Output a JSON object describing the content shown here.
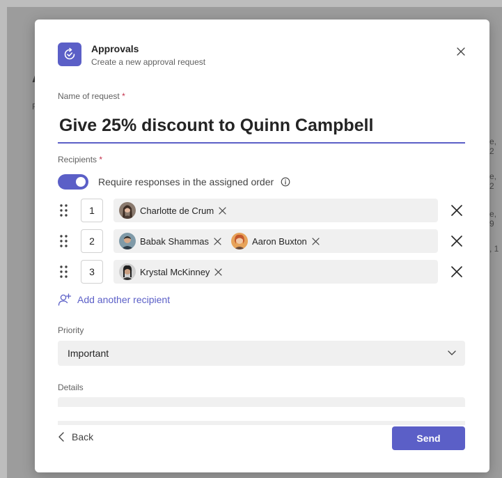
{
  "background": {
    "fragments": [
      "A",
      "F",
      "e, 2",
      "e, 2",
      "e, 9",
      ", 1"
    ]
  },
  "dialog": {
    "app_title": "Approvals",
    "app_subtitle": "Create a new approval request",
    "name_label": "Name of request",
    "required_mark": "*",
    "name_value": "Give 25% discount to Quinn Campbell",
    "recipients_label": "Recipients",
    "toggle_label": "Require responses in the assigned order",
    "toggle_on": true,
    "recipients": [
      {
        "order": "1",
        "people": [
          "Charlotte de Crum"
        ]
      },
      {
        "order": "2",
        "people": [
          "Babak Shammas",
          "Aaron Buxton"
        ]
      },
      {
        "order": "3",
        "people": [
          "Krystal McKinney"
        ]
      }
    ],
    "add_recipient": "Add another recipient",
    "priority_label": "Priority",
    "priority_value": "Important",
    "details_label": "Details",
    "back_label": "Back",
    "send_label": "Send"
  },
  "colors": {
    "accent": "#5b5fc7",
    "required": "#c4314b"
  }
}
